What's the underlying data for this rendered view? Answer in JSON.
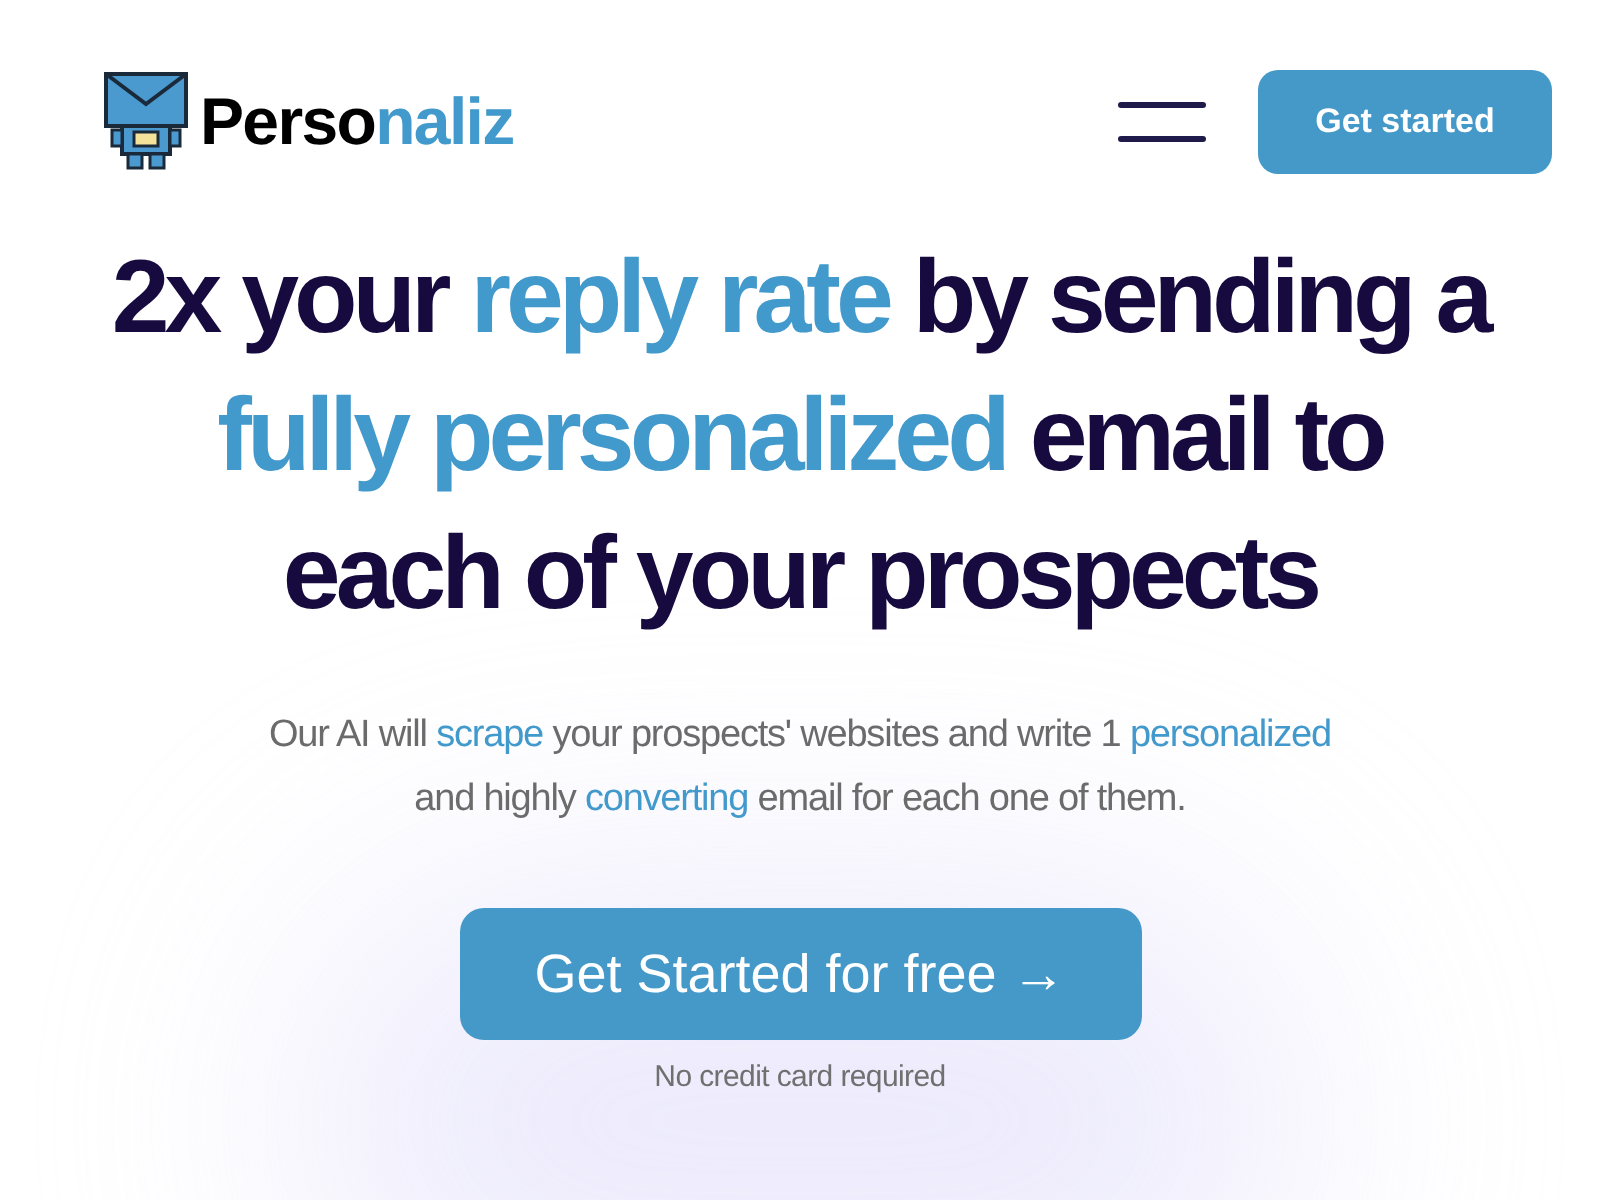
{
  "header": {
    "logo": [
      {
        "text": "Perso",
        "highlight": false
      },
      {
        "text": "naliz",
        "highlight": true
      }
    ],
    "cta": "Get started"
  },
  "headline": [
    [
      {
        "text": "2x your ",
        "highlight": false
      },
      {
        "text": "reply rate",
        "highlight": true
      },
      {
        "text": " by sending a",
        "highlight": false
      }
    ],
    [
      {
        "text": "fully personalized",
        "highlight": true
      },
      {
        "text": " email to",
        "highlight": false
      }
    ],
    [
      {
        "text": "each of your prospects",
        "highlight": false
      }
    ]
  ],
  "subtitle": [
    [
      {
        "text": "Our AI will ",
        "highlight": false
      },
      {
        "text": "scrape",
        "highlight": true
      },
      {
        "text": " your prospects' websites and write 1 ",
        "highlight": false
      },
      {
        "text": "personalized",
        "highlight": true
      }
    ],
    [
      {
        "text": "and highly ",
        "highlight": false
      },
      {
        "text": "converting",
        "highlight": true
      },
      {
        "text": " email for each one of them.",
        "highlight": false
      }
    ]
  ],
  "main_button": "Get Started for free →",
  "note": "No credit card required"
}
